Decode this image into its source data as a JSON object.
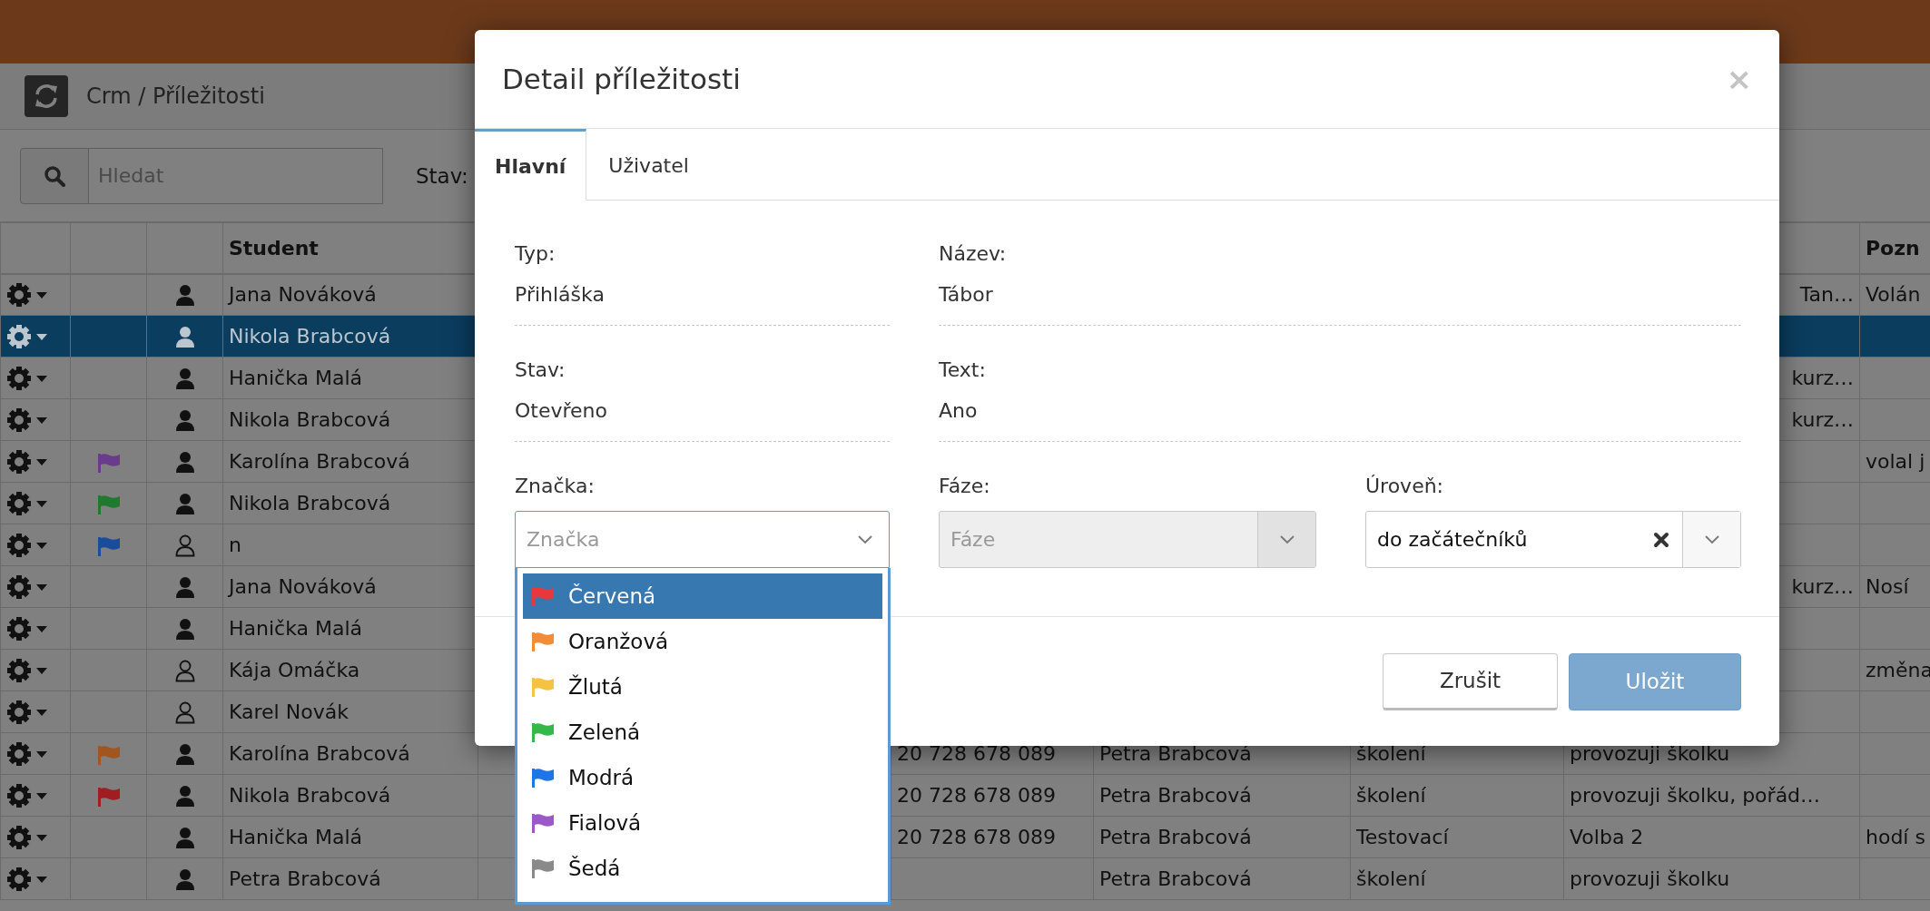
{
  "page": {
    "breadcrumb": "Crm / Příležitosti",
    "search": {
      "placeholder": "Hledat"
    },
    "filter_label": "Stav:"
  },
  "table": {
    "header": {
      "student": "Student",
      "column_10": "Pozn"
    },
    "rows": [
      {
        "selected": false,
        "person": {
          "kind": "filled"
        },
        "student": "Jana Nováková",
        "column_9_tail": "Tan…",
        "column_10": "Volán"
      },
      {
        "selected": true,
        "person": {
          "kind": "filled"
        },
        "student": "Nikola Brabcová"
      },
      {
        "selected": false,
        "person": {
          "kind": "filled"
        },
        "student": "Hanička Malá",
        "column_9_tail": "kurz…"
      },
      {
        "selected": false,
        "person": {
          "kind": "filled"
        },
        "student": "Nikola Brabcová",
        "column_9_tail": "kurz…"
      },
      {
        "selected": false,
        "flag": {
          "color": "#6a3a8c"
        },
        "person": {
          "kind": "filled"
        },
        "student": "Karolína Brabcová",
        "column_10": "volal j"
      },
      {
        "selected": false,
        "flag": {
          "color": "#1f7a2f"
        },
        "person": {
          "kind": "filled"
        },
        "student": "Nikola Brabcová"
      },
      {
        "selected": false,
        "flag": {
          "color": "#1a4c9c"
        },
        "person": {
          "kind": "outline"
        },
        "student": "n"
      },
      {
        "selected": false,
        "person": {
          "kind": "filled"
        },
        "student": "Jana Nováková",
        "column_9_tail": "kurz…",
        "column_10": "Nosí"
      },
      {
        "selected": false,
        "person": {
          "kind": "filled"
        },
        "student": "Hanička Malá"
      },
      {
        "selected": false,
        "person": {
          "kind": "outline"
        },
        "student": "Kája Omáčka",
        "column_10": "změna"
      },
      {
        "selected": false,
        "person": {
          "kind": "outline"
        },
        "student": "Karel Novák"
      },
      {
        "selected": false,
        "flag": {
          "color": "#a0561e"
        },
        "person": {
          "kind": "filled"
        },
        "student": "Karolína Brabcová",
        "column_6": "20 728 678 089",
        "column_7": "Petra Brabcová",
        "column_8": "školení",
        "column_9": "provozuji školku"
      },
      {
        "selected": false,
        "flag": {
          "color": "#a01e22"
        },
        "person": {
          "kind": "filled"
        },
        "student": "Nikola Brabcová",
        "column_6": "20 728 678 089",
        "column_7": "Petra Brabcová",
        "column_8": "školení",
        "column_9": "provozuji školku, pořád…"
      },
      {
        "selected": false,
        "person": {
          "kind": "filled"
        },
        "student": "Hanička Malá",
        "column_6": "20 728 678 089",
        "column_7": "Petra Brabcová",
        "column_8": "Testovací",
        "column_9": "Volba 2",
        "column_10": "hodí s"
      },
      {
        "selected": false,
        "person": {
          "kind": "filled"
        },
        "student": "Petra Brabcová",
        "column_7": "Petra Brabcová",
        "column_8": "školení",
        "column_9": "provozuji školku"
      }
    ]
  },
  "dialog": {
    "title": "Detail příležitosti",
    "close": "×",
    "tabs": [
      {
        "label": "Hlavní",
        "selected": true
      },
      {
        "label": "Uživatel",
        "selected": false
      }
    ],
    "fields": [
      {
        "label": "Typ:",
        "value": "Přihláška",
        "wide": false
      },
      {
        "label": "Název:",
        "value": "Tábor",
        "wide": true
      },
      {
        "label": "Stav:",
        "value": "Otevřeno",
        "wide": false
      },
      {
        "label": "Text:",
        "value": "Ano",
        "wide": true
      }
    ],
    "selects": [
      {
        "kind": "plain",
        "label": "Značka:",
        "placeholder": "Značka",
        "expanded": true,
        "disabled": false,
        "options": [
          {
            "label": "Červená",
            "color": "#e8383d",
            "selected": true
          },
          {
            "label": "Oranžová",
            "color": "#f28c38",
            "selected": false
          },
          {
            "label": "Žlutá",
            "color": "#f5c242",
            "selected": false
          },
          {
            "label": "Zelená",
            "color": "#35b84a",
            "selected": false
          },
          {
            "label": "Modrá",
            "color": "#1f75e8",
            "selected": false
          },
          {
            "label": "Fialová",
            "color": "#9b59c8",
            "selected": false
          },
          {
            "label": "Šedá",
            "color": "#8a8a8a",
            "selected": false
          }
        ]
      },
      {
        "kind": "split",
        "label": "Fáze:",
        "placeholder": "Fáze",
        "expanded": false,
        "disabled": true
      },
      {
        "kind": "split",
        "label": "Úroveň:",
        "value": "do začátečníků",
        "clearable": true,
        "expanded": false,
        "disabled": false
      }
    ],
    "buttons": [
      {
        "label": "Zrušit",
        "kind": "default"
      },
      {
        "label": "Uložit",
        "kind": "primary"
      }
    ]
  }
}
